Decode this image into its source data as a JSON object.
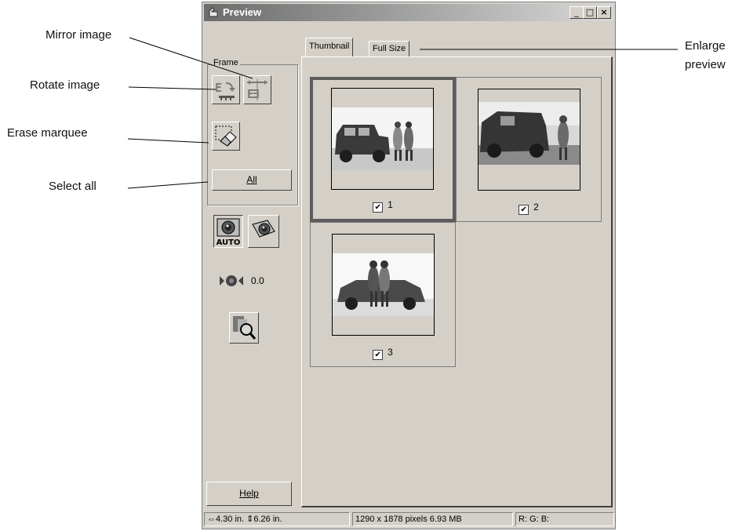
{
  "callouts": {
    "mirror": "Mirror image",
    "rotate": "Rotate image",
    "erase": "Erase marquee",
    "select_all": "Select all",
    "enlarge_line1": "Enlarge",
    "enlarge_line2": "preview"
  },
  "window": {
    "title": "Preview",
    "minimize": "_",
    "maximize": "□",
    "close": "×"
  },
  "frame_group": {
    "label": "Frame",
    "all_button": "All"
  },
  "exposure_value": "0.0",
  "help_button": "Help",
  "tabs": [
    {
      "label": "Thumbnail",
      "selected": true
    },
    {
      "label": "Full Size",
      "selected": false
    }
  ],
  "thumbnails": [
    {
      "number": "1",
      "checked": true,
      "selected": true
    },
    {
      "number": "2",
      "checked": true,
      "selected": false
    },
    {
      "number": "3",
      "checked": true,
      "selected": false
    }
  ],
  "status": {
    "width": "4.30 in.",
    "height": "6.26 in.",
    "pixels": "1290 x 1878 pixels 6.93 MB",
    "rgb": "R: G: B:"
  }
}
